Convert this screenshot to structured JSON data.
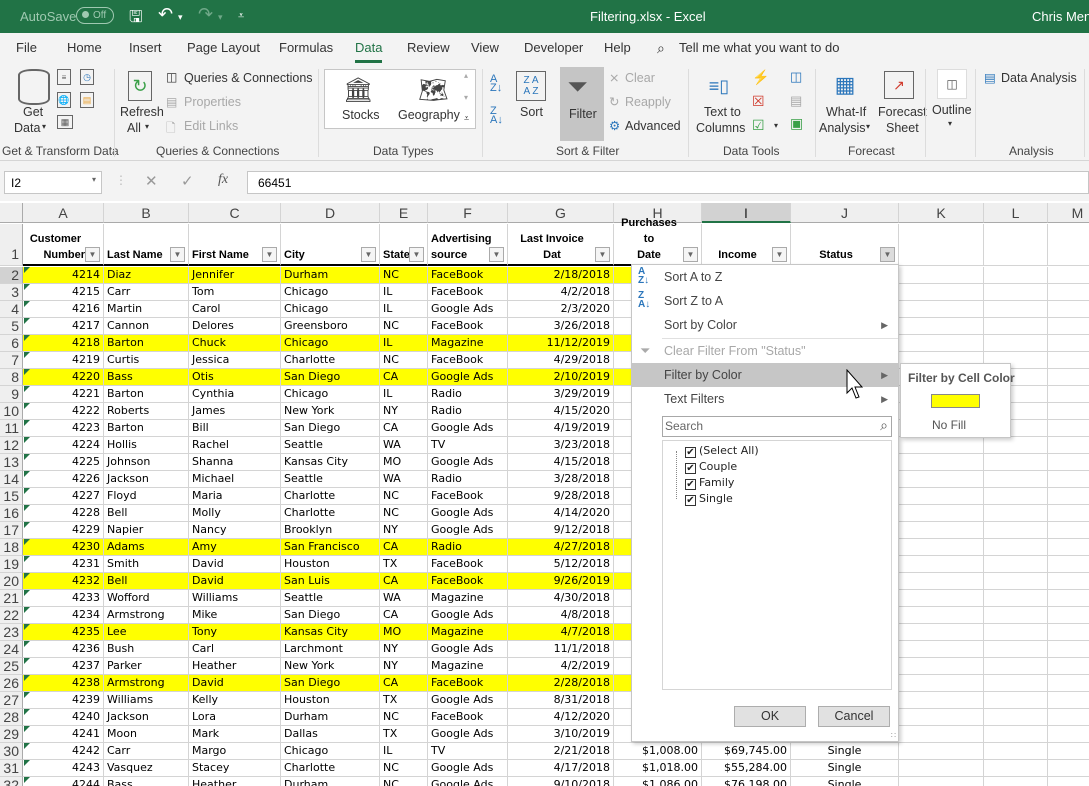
{
  "titlebar": {
    "autosave_label": "AutoSave",
    "autosave_state": "Off",
    "title": "Filtering.xlsx  -  Excel",
    "user": "Chris Menard"
  },
  "tabs": [
    "File",
    "Home",
    "Insert",
    "Page Layout",
    "Formulas",
    "Data",
    "Review",
    "View",
    "Developer",
    "Help"
  ],
  "active_tab": "Data",
  "tell_me": "Tell me what you want to do",
  "ribbon": {
    "get_data": "Get",
    "get_data2": "Data",
    "refresh": "Refresh",
    "refresh2": "All",
    "queries_connections": "Queries & Connections",
    "properties": "Properties",
    "edit_links": "Edit Links",
    "stocks": "Stocks",
    "geography": "Geography",
    "sort": "Sort",
    "filter": "Filter",
    "clear": "Clear",
    "reapply": "Reapply",
    "advanced": "Advanced",
    "text_to": "Text to",
    "columns": "Columns",
    "what_if": "What-If",
    "analysis": "Analysis",
    "forecast": "Forecast",
    "sheet": "Sheet",
    "outline": "Outline",
    "data_analysis": "Data Analysis",
    "groups": {
      "get_transform": "Get & Transform Data",
      "queries": "Queries & Connections",
      "data_types": "Data Types",
      "sort_filter": "Sort & Filter",
      "data_tools": "Data Tools",
      "forecast": "Forecast",
      "analysis": "Analysis"
    }
  },
  "formula_bar": {
    "name_box": "I2",
    "value": "66451"
  },
  "columns": [
    "A",
    "B",
    "C",
    "D",
    "E",
    "F",
    "G",
    "H",
    "I",
    "J",
    "K",
    "L",
    "M"
  ],
  "selected_column": "I",
  "headers": {
    "A": [
      "Customer",
      "Number"
    ],
    "B": [
      "Last Name"
    ],
    "C": [
      "First Name"
    ],
    "D": [
      "City"
    ],
    "E": [
      "State"
    ],
    "F": [
      "Advertising",
      "source"
    ],
    "G": [
      "Last Invoice Dat"
    ],
    "H": [
      "Purchases to",
      "Date"
    ],
    "I": [
      "Income"
    ],
    "J": [
      "Status"
    ]
  },
  "rows": [
    {
      "n": "2",
      "num": "4214",
      "last": "Diaz",
      "first": "Jennifer",
      "city": "Durham",
      "state": "NC",
      "src": "FaceBook",
      "date": "2/18/2018",
      "yellow": true
    },
    {
      "n": "3",
      "num": "4215",
      "last": "Carr",
      "first": "Tom",
      "city": "Chicago",
      "state": "IL",
      "src": "FaceBook",
      "date": "4/2/2018",
      "yellow": false
    },
    {
      "n": "4",
      "num": "4216",
      "last": "Martin",
      "first": "Carol",
      "city": "Chicago",
      "state": "IL",
      "src": "Google Ads",
      "date": "2/3/2020",
      "yellow": false
    },
    {
      "n": "5",
      "num": "4217",
      "last": "Cannon",
      "first": "Delores",
      "city": "Greensboro",
      "state": "NC",
      "src": "FaceBook",
      "date": "3/26/2018",
      "yellow": false
    },
    {
      "n": "6",
      "num": "4218",
      "last": "Barton",
      "first": "Chuck",
      "city": "Chicago",
      "state": "IL",
      "src": "Magazine",
      "date": "11/12/2019",
      "yellow": true
    },
    {
      "n": "7",
      "num": "4219",
      "last": "Curtis",
      "first": "Jessica",
      "city": "Charlotte",
      "state": "NC",
      "src": "FaceBook",
      "date": "4/29/2018",
      "yellow": false
    },
    {
      "n": "8",
      "num": "4220",
      "last": "Bass",
      "first": "Otis",
      "city": "San Diego",
      "state": "CA",
      "src": "Google Ads",
      "date": "2/10/2019",
      "yellow": true
    },
    {
      "n": "9",
      "num": "4221",
      "last": "Barton",
      "first": "Cynthia",
      "city": "Chicago",
      "state": "IL",
      "src": "Radio",
      "date": "3/29/2019",
      "yellow": false
    },
    {
      "n": "10",
      "num": "4222",
      "last": "Roberts",
      "first": "James",
      "city": "New York",
      "state": "NY",
      "src": "Radio",
      "date": "4/15/2020",
      "yellow": false
    },
    {
      "n": "11",
      "num": "4223",
      "last": "Barton",
      "first": "Bill",
      "city": "San Diego",
      "state": "CA",
      "src": "Google Ads",
      "date": "4/19/2019",
      "yellow": false
    },
    {
      "n": "12",
      "num": "4224",
      "last": "Hollis",
      "first": "Rachel",
      "city": "Seattle",
      "state": "WA",
      "src": "TV",
      "date": "3/23/2018",
      "yellow": false
    },
    {
      "n": "13",
      "num": "4225",
      "last": "Johnson",
      "first": "Shanna",
      "city": "Kansas City",
      "state": "MO",
      "src": "Google Ads",
      "date": "4/15/2018",
      "yellow": false
    },
    {
      "n": "14",
      "num": "4226",
      "last": "Jackson",
      "first": "Michael",
      "city": "Seattle",
      "state": "WA",
      "src": "Radio",
      "date": "3/28/2018",
      "yellow": false
    },
    {
      "n": "15",
      "num": "4227",
      "last": "Floyd",
      "first": "Maria",
      "city": "Charlotte",
      "state": "NC",
      "src": "FaceBook",
      "date": "9/28/2018",
      "yellow": false
    },
    {
      "n": "16",
      "num": "4228",
      "last": "Bell",
      "first": "Molly",
      "city": "Charlotte",
      "state": "NC",
      "src": "Google Ads",
      "date": "4/14/2020",
      "yellow": false
    },
    {
      "n": "17",
      "num": "4229",
      "last": "Napier",
      "first": "Nancy",
      "city": "Brooklyn",
      "state": "NY",
      "src": "Google Ads",
      "date": "9/12/2018",
      "yellow": false
    },
    {
      "n": "18",
      "num": "4230",
      "last": "Adams",
      "first": "Amy",
      "city": "San Francisco",
      "state": "CA",
      "src": "Radio",
      "date": "4/27/2018",
      "yellow": true
    },
    {
      "n": "19",
      "num": "4231",
      "last": "Smith",
      "first": "David",
      "city": "Houston",
      "state": "TX",
      "src": "FaceBook",
      "date": "5/12/2018",
      "yellow": false
    },
    {
      "n": "20",
      "num": "4232",
      "last": "Bell",
      "first": "David",
      "city": "San Luis",
      "state": "CA",
      "src": "FaceBook",
      "date": "9/26/2019",
      "yellow": true
    },
    {
      "n": "21",
      "num": "4233",
      "last": "Wofford",
      "first": "Williams",
      "city": "Seattle",
      "state": "WA",
      "src": "Magazine",
      "date": "4/30/2018",
      "yellow": false
    },
    {
      "n": "22",
      "num": "4234",
      "last": "Armstrong",
      "first": "Mike",
      "city": "San Diego",
      "state": "CA",
      "src": "Google Ads",
      "date": "4/8/2018",
      "yellow": false
    },
    {
      "n": "23",
      "num": "4235",
      "last": "Lee",
      "first": "Tony",
      "city": "Kansas City",
      "state": "MO",
      "src": "Magazine",
      "date": "4/7/2018",
      "yellow": true
    },
    {
      "n": "24",
      "num": "4236",
      "last": "Bush",
      "first": "Carl",
      "city": "Larchmont",
      "state": "NY",
      "src": "Google Ads",
      "date": "11/1/2018",
      "yellow": false
    },
    {
      "n": "25",
      "num": "4237",
      "last": "Parker",
      "first": "Heather",
      "city": "New York",
      "state": "NY",
      "src": "Magazine",
      "date": "4/2/2019",
      "yellow": false
    },
    {
      "n": "26",
      "num": "4238",
      "last": "Armstrong",
      "first": "David",
      "city": "San Diego",
      "state": "CA",
      "src": "FaceBook",
      "date": "2/28/2018",
      "yellow": true
    },
    {
      "n": "27",
      "num": "4239",
      "last": "Williams",
      "first": "Kelly",
      "city": "Houston",
      "state": "TX",
      "src": "Google Ads",
      "date": "8/31/2018",
      "yellow": false
    },
    {
      "n": "28",
      "num": "4240",
      "last": "Jackson",
      "first": "Lora",
      "city": "Durham",
      "state": "NC",
      "src": "FaceBook",
      "date": "4/12/2020",
      "yellow": false
    },
    {
      "n": "29",
      "num": "4241",
      "last": "Moon",
      "first": "Mark",
      "city": "Dallas",
      "state": "TX",
      "src": "Google Ads",
      "date": "3/10/2019",
      "yellow": false
    },
    {
      "n": "30",
      "num": "4242",
      "last": "Carr",
      "first": "Margo",
      "city": "Chicago",
      "state": "IL",
      "src": "TV",
      "date": "2/21/2018",
      "yellow": false,
      "purch": "$1,008.00",
      "income": "$69,745.00",
      "status": "Single"
    },
    {
      "n": "31",
      "num": "4243",
      "last": "Vasquez",
      "first": "Stacey",
      "city": "Charlotte",
      "state": "NC",
      "src": "Google Ads",
      "date": "4/17/2018",
      "yellow": false,
      "purch": "$1,018.00",
      "income": "$55,284.00",
      "status": "Single"
    },
    {
      "n": "32",
      "num": "4244",
      "last": "Bass",
      "first": "Heather",
      "city": "Durham",
      "state": "NC",
      "src": "Google Ads",
      "date": "9/10/2018",
      "yellow": false,
      "purch": "$1,086.00",
      "income": "$76,198.00",
      "status": "Single"
    }
  ],
  "filter_menu": {
    "sort_az": "Sort A to Z",
    "sort_za": "Sort Z to A",
    "sort_by_color": "Sort by Color",
    "clear_filter": "Clear Filter From \"Status\"",
    "filter_by_color": "Filter by Color",
    "text_filters": "Text Filters",
    "search_placeholder": "Search",
    "items": [
      {
        "label": "(Select All)",
        "checked": true
      },
      {
        "label": "Couple",
        "checked": true
      },
      {
        "label": "Family",
        "checked": true
      },
      {
        "label": "Single",
        "checked": true
      }
    ],
    "ok": "OK",
    "cancel": "Cancel"
  },
  "color_submenu": {
    "title": "Filter by Cell Color",
    "swatch_color": "#ffff00",
    "no_fill": "No Fill"
  }
}
